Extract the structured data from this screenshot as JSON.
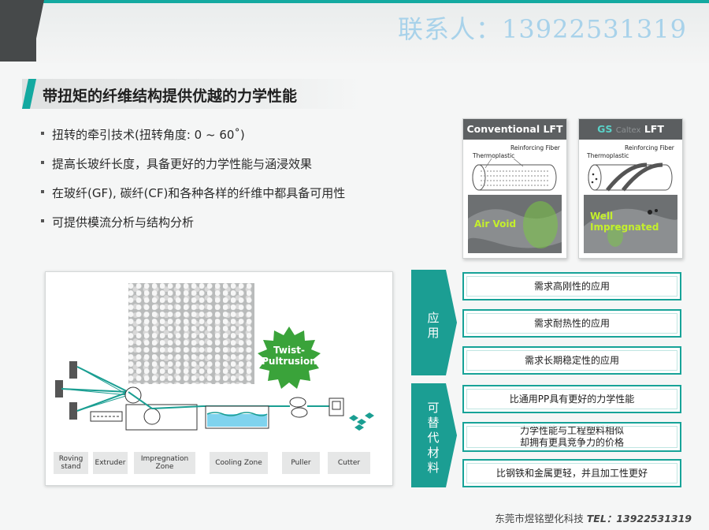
{
  "header": {
    "contact": "联系人：13922531319"
  },
  "title": "带扭矩的纤维结构提供优越的力学性能",
  "bullets": [
    "扭转的牵引技术(扭转角度: 0 ~ 60˚)",
    "提高长玻纤长度，具备更好的力学性能与涵浸效果",
    "在玻纤(GF), 碳纤(CF)和各种各样的纤维中都具备可用性",
    "可提供模流分析与结构分析"
  ],
  "panels": {
    "conventional": {
      "title": "Conventional LFT",
      "fiber_label": "Reinforcing Fiber",
      "thermo_label": "Thermoplastic",
      "photo_text": "Air Void"
    },
    "gs": {
      "title_prefix": "GS",
      "title_mid": "Caltex",
      "title_suffix": "LFT",
      "fiber_label": "Reinforcing Fiber",
      "thermo_label": "Thermoplastic",
      "photo_text_1": "Well",
      "photo_text_2": "Impregnated"
    }
  },
  "process": {
    "badge_1": "Twist-",
    "badge_2": "Pultrusion",
    "stages": [
      "Roving stand",
      "Extruder",
      "Impregnation Zone",
      "Cooling Zone",
      "Puller",
      "Cutter"
    ]
  },
  "application": {
    "label": [
      "应",
      "用"
    ],
    "items": [
      "需求高刚性的应用",
      "需求耐热性的应用",
      "需求长期稳定性的应用"
    ]
  },
  "alternative": {
    "label": [
      "可",
      "替",
      "代",
      "材",
      "料"
    ],
    "items": [
      "比通用PP具有更好的力学性能",
      "力学性能与工程塑料相似",
      "却拥有更具竞争力的价格",
      "比钢铁和金属更轻，并且加工性更好"
    ]
  },
  "footer": {
    "company": "东莞市煜铭塑化科技 ",
    "tel": "TEL：13922531319"
  },
  "colors": {
    "accent": "#13a9a0",
    "item_border": "#17a398",
    "photo_text": "#c4ef2c"
  }
}
